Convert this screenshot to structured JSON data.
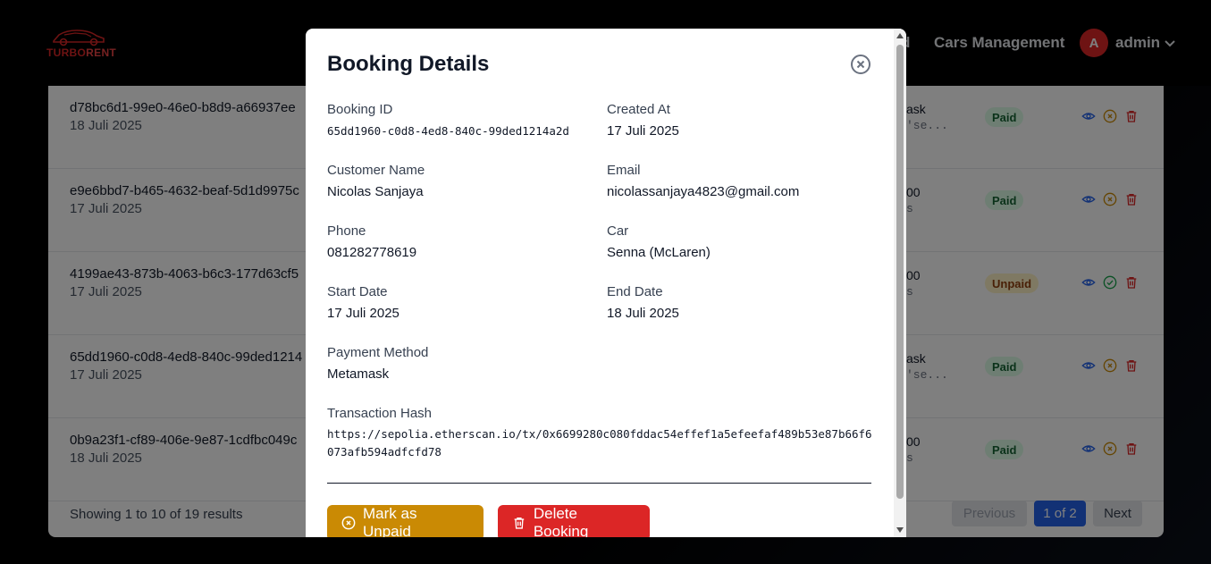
{
  "header": {
    "logo": {
      "part1": "TURBO",
      "part2": "RENT"
    },
    "nav_partial": "d",
    "nav_cars": "Cars Management",
    "user": {
      "initial": "A",
      "name": "admin"
    }
  },
  "table": {
    "rows": [
      {
        "id": "d78bc6d1-99e0-46e0-b8d9-a66937ee",
        "date": "18 Juli 2025",
        "pm1": "ask",
        "pm2": "'se...",
        "status": "Paid",
        "verify_icon": "x-circle-icon"
      },
      {
        "id": "e9e6bbd7-b465-4632-beaf-5d1d9975c",
        "date": "17 Juli 2025",
        "pm1": "00",
        "pm2": "s",
        "status": "Paid",
        "verify_icon": "x-circle-icon"
      },
      {
        "id": "4199ae43-873b-4063-b6c3-177d63cf5",
        "date": "17 Juli 2025",
        "pm1": "00",
        "pm2": "s",
        "status": "Unpaid",
        "verify_icon": "check-circle-icon"
      },
      {
        "id": "65dd1960-c0d8-4ed8-840c-99ded1214",
        "date": "17 Juli 2025",
        "pm1": "ask",
        "pm2": "'se...",
        "status": "Paid",
        "verify_icon": "x-circle-icon"
      },
      {
        "id": "0b9a23f1-cf89-406e-9e87-1cdfbc049c",
        "date": "18 Juli 2025",
        "pm1": "00",
        "pm2": "s",
        "status": "Paid",
        "verify_icon": "x-circle-icon"
      }
    ],
    "footer": {
      "info": "Showing 1 to 10 of 19 results",
      "prev": "Previous",
      "current": "1 of 2",
      "next": "Next"
    }
  },
  "modal": {
    "title": "Booking Details",
    "fields": {
      "booking_id": {
        "label": "Booking ID",
        "value": "65dd1960-c0d8-4ed8-840c-99ded1214a2d"
      },
      "created_at": {
        "label": "Created At",
        "value": "17 Juli 2025"
      },
      "customer_name": {
        "label": "Customer Name",
        "value": "Nicolas Sanjaya"
      },
      "email": {
        "label": "Email",
        "value": "nicolassanjaya4823@gmail.com"
      },
      "phone": {
        "label": "Phone",
        "value": "081282778619"
      },
      "car": {
        "label": "Car",
        "value": "Senna (McLaren)"
      },
      "start_date": {
        "label": "Start Date",
        "value": "17 Juli 2025"
      },
      "end_date": {
        "label": "End Date",
        "value": "18 Juli 2025"
      },
      "payment_method": {
        "label": "Payment Method",
        "value": "Metamask"
      },
      "transaction_hash": {
        "label": "Transaction Hash",
        "value": "https://sepolia.etherscan.io/tx/0x6699280c080fddac54effef1a5efeefaf489b53e87b66f6073afb594adfcfd78"
      }
    },
    "buttons": {
      "mark_unpaid": "Mark as Unpaid",
      "delete": "Delete Booking"
    }
  },
  "colors": {
    "primary": "#2563eb",
    "danger": "#dc2626",
    "warning": "#ca8a04",
    "paid_bg": "#dcfce7",
    "unpaid_bg": "#fef3c7"
  }
}
